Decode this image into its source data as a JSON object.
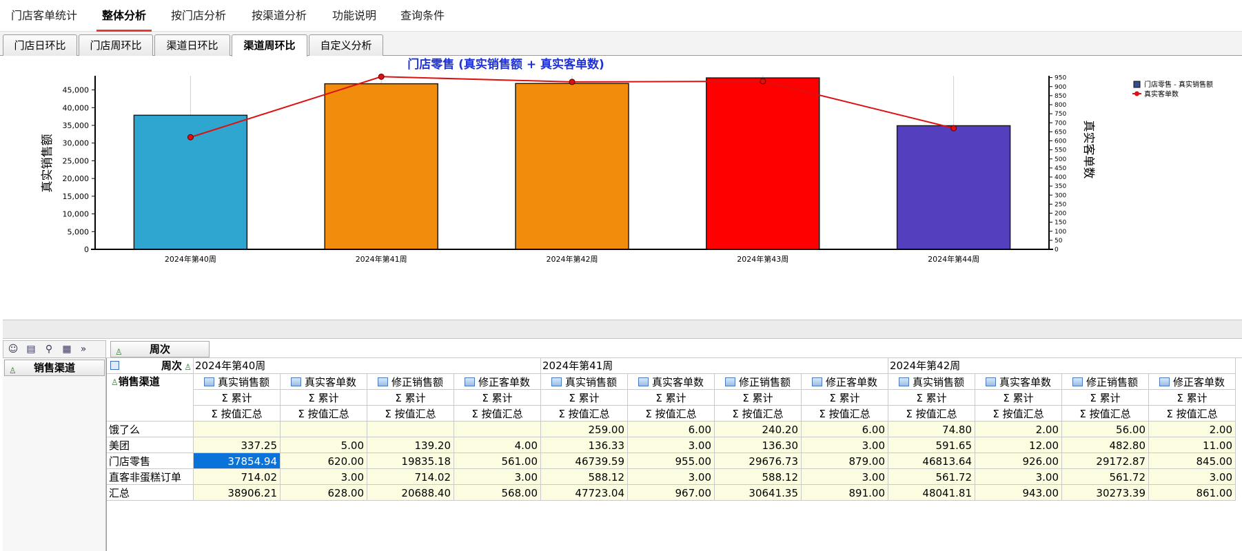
{
  "topnav": {
    "items": [
      {
        "label": "门店客单统计",
        "active": false
      },
      {
        "label": "整体分析",
        "active": true
      },
      {
        "label": "按门店分析",
        "active": false
      },
      {
        "label": "按渠道分析",
        "active": false
      },
      {
        "label": "功能说明",
        "active": false
      },
      {
        "label": "查询条件",
        "active": false
      }
    ],
    "accent": "#e53935"
  },
  "subtabs": {
    "items": [
      {
        "label": "门店日环比",
        "active": false
      },
      {
        "label": "门店周环比",
        "active": false
      },
      {
        "label": "渠道日环比",
        "active": false
      },
      {
        "label": "渠道周环比",
        "active": true
      },
      {
        "label": "自定义分析",
        "active": false
      }
    ]
  },
  "chart_data": {
    "type": "bar",
    "title": "门店零售 (真实销售额 + 真实客单数)",
    "categories": [
      "2024年第40周",
      "2024年第41周",
      "2024年第42周",
      "2024年第43周",
      "2024年第44周"
    ],
    "series": [
      {
        "name": "门店零售 - 真实销售额",
        "type": "bar",
        "axis": "left",
        "values": [
          37854.94,
          46739.59,
          46813.64,
          48400,
          34900
        ],
        "colors": [
          "#2fa6d0",
          "#f28c0c",
          "#f28c0c",
          "#ff0000",
          "#5440bf"
        ]
      },
      {
        "name": "真实客单数",
        "type": "line",
        "axis": "right",
        "values": [
          620,
          955,
          926,
          930,
          670
        ],
        "color": "#dd1111"
      }
    ],
    "ylabel": "真实销售额",
    "y2label": "真实客单数",
    "ylim": [
      0,
      49000
    ],
    "y2lim": [
      0,
      960
    ],
    "yticks": [
      0,
      5000,
      10000,
      15000,
      20000,
      25000,
      30000,
      35000,
      40000,
      45000
    ],
    "ytick_labels": [
      "0",
      "5,000",
      "10,000",
      "15,000",
      "20,000",
      "25,000",
      "30,000",
      "35,000",
      "40,000",
      "45,000"
    ],
    "y2ticks": [
      0,
      50,
      100,
      150,
      200,
      250,
      300,
      350,
      400,
      450,
      500,
      550,
      600,
      650,
      700,
      750,
      800,
      850,
      900,
      950
    ],
    "legend_position": "top-right",
    "grid": false
  },
  "pivot": {
    "col_field": "周次",
    "row_field": "销售渠道",
    "weeks": [
      "2024年第40周",
      "2024年第41周",
      "2024年第42周"
    ],
    "measures": [
      "真实销售额",
      "真实客单数",
      "修正销售额",
      "修正客单数"
    ],
    "agg1": "Σ 累计",
    "agg2": "Σ 按值汇总",
    "rows": [
      {
        "label": "饿了么",
        "values": [
          "",
          "",
          "",
          "",
          "259.00",
          "6.00",
          "240.20",
          "6.00",
          "74.80",
          "2.00",
          "56.00",
          "2.00"
        ]
      },
      {
        "label": "美团",
        "values": [
          "337.25",
          "5.00",
          "139.20",
          "4.00",
          "136.33",
          "3.00",
          "136.30",
          "3.00",
          "591.65",
          "12.00",
          "482.80",
          "11.00"
        ]
      },
      {
        "label": "门店零售",
        "values": [
          "37854.94",
          "620.00",
          "19835.18",
          "561.00",
          "46739.59",
          "955.00",
          "29676.73",
          "879.00",
          "46813.64",
          "926.00",
          "29172.87",
          "845.00"
        ]
      },
      {
        "label": "直客非蛋糕订单",
        "values": [
          "714.02",
          "3.00",
          "714.02",
          "3.00",
          "588.12",
          "3.00",
          "588.12",
          "3.00",
          "561.72",
          "3.00",
          "561.72",
          "3.00"
        ]
      },
      {
        "label": "汇总",
        "values": [
          "38906.21",
          "628.00",
          "20688.40",
          "568.00",
          "47723.04",
          "967.00",
          "30641.35",
          "891.00",
          "48041.81",
          "943.00",
          "30273.39",
          "861.00"
        ]
      }
    ]
  }
}
